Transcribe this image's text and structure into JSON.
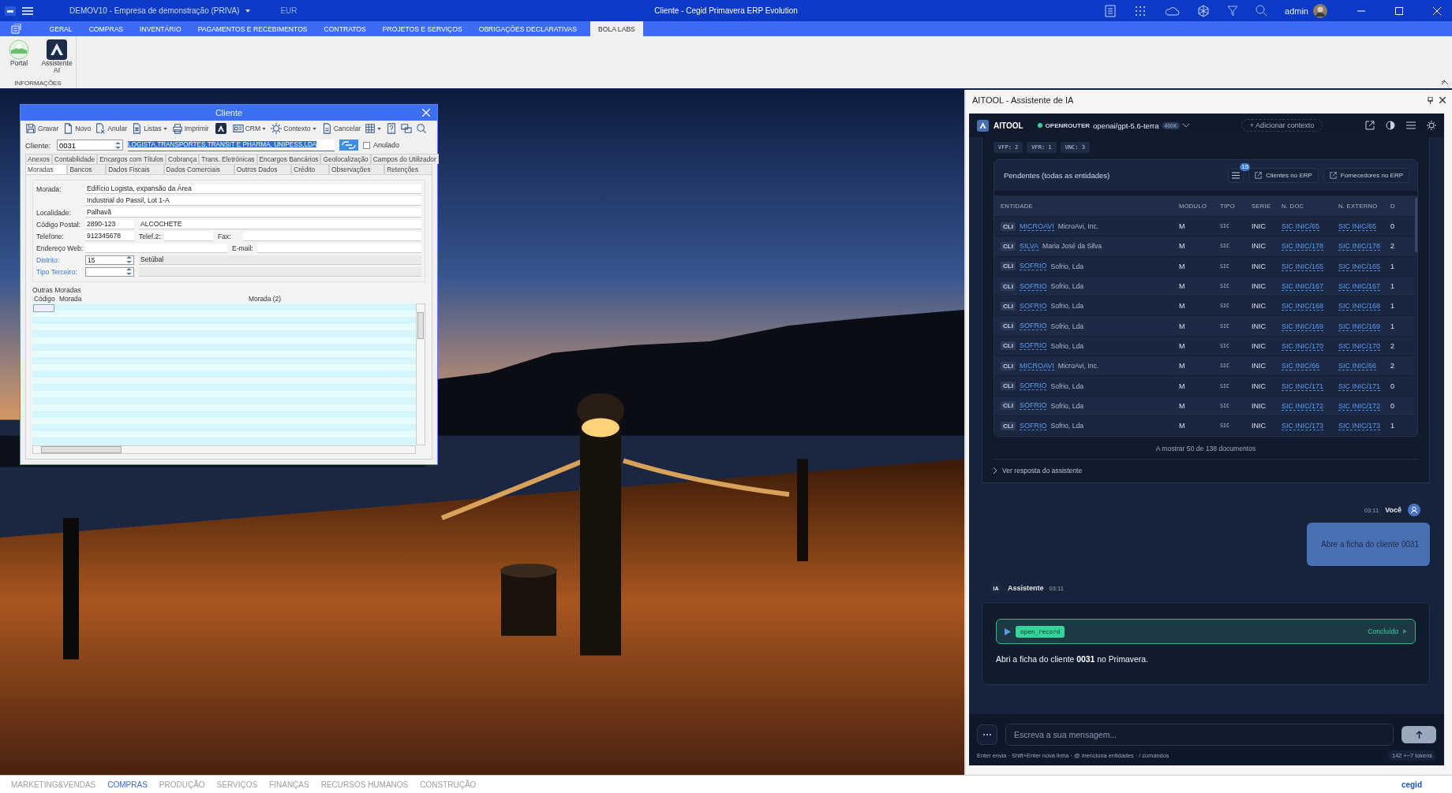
{
  "title_bar": {
    "company": "DEMOV10 - Empresa de demonstração (PRIVA)",
    "currency": "EUR",
    "title": "Cliente - Cegid Primavera ERP Evolution",
    "user": "admin"
  },
  "ribbon": {
    "tabs": [
      {
        "label": "GERAL",
        "selected": false
      },
      {
        "label": "COMPRAS",
        "selected": false
      },
      {
        "label": "INVENTÁRIO",
        "selected": false
      },
      {
        "label": "PAGAMENTOS E RECEBIMENTOS",
        "selected": false
      },
      {
        "label": "CONTRATOS",
        "selected": false
      },
      {
        "label": "PROJETOS E SERVIÇOS",
        "selected": false
      },
      {
        "label": "OBRIGAÇÕES DECLARATIVAS",
        "selected": false
      },
      {
        "label": "BOLA LABS",
        "selected": true
      }
    ],
    "buttons": [
      {
        "label": "Portal",
        "kind": "portal"
      },
      {
        "label": "Assistente AI",
        "kind": "assistant"
      }
    ],
    "group": "INFORMAÇÕES"
  },
  "client_window": {
    "title": "Cliente",
    "toolbar": [
      {
        "kind": "save",
        "label": "Gravar",
        "dropdown": false
      },
      {
        "kind": "new",
        "label": "Novo",
        "dropdown": false
      },
      {
        "kind": "void",
        "label": "Anular",
        "dropdown": false
      },
      {
        "kind": "lists",
        "label": "Listas",
        "dropdown": true
      },
      {
        "kind": "print",
        "label": "Imprimir",
        "dropdown": false
      },
      {
        "kind": "ai",
        "dropdown": false
      },
      {
        "kind": "crm",
        "label": "CRM",
        "dropdown": true
      },
      {
        "kind": "context",
        "label": "Contexto",
        "dropdown": true
      },
      {
        "kind": "cancel",
        "label": "Cancelar",
        "dropdown": false
      },
      {
        "kind": "grid",
        "dropdown": true
      },
      {
        "kind": "help",
        "dropdown": false
      },
      {
        "kind": "switch",
        "dropdown": false
      },
      {
        "kind": "search",
        "dropdown": false
      }
    ],
    "code_label": "Cliente:",
    "code": "0031",
    "name": "LOGISTA,TRANSPORTES,TRANSIT E PHARMA, UNIPESS,LDA",
    "void": {
      "label": "Anulado",
      "checked": false
    },
    "tabs_row_1": [
      {
        "label": "Anexos",
        "selected": false
      },
      {
        "label": "Contabilidade",
        "selected": false
      },
      {
        "label": "Encargos com Títulos",
        "selected": false
      },
      {
        "label": "Cobrança",
        "selected": false
      },
      {
        "label": "Trans. Eletrónicas",
        "selected": false
      },
      {
        "label": "Encargos Bancários",
        "selected": false
      },
      {
        "label": "Geolocalização",
        "selected": false
      },
      {
        "label": "Campos do Utilizador",
        "selected": false
      }
    ],
    "tabs_row_2": [
      {
        "label": "Moradas",
        "selected": true
      },
      {
        "label": "Bancos",
        "selected": false
      },
      {
        "label": "Dados Fiscais",
        "selected": false
      },
      {
        "label": "Dados Comerciais",
        "selected": false
      },
      {
        "label": "Outros Dados",
        "selected": false
      },
      {
        "label": "Crédito",
        "selected": false
      },
      {
        "label": "Observações",
        "selected": false
      },
      {
        "label": "Retenções",
        "selected": false
      }
    ],
    "address": {
      "morada_label": "Morada:",
      "morada_1": "Edifício Logista, expansão da Área",
      "morada_2": "Industrial do Passil, Lot 1-A",
      "localidade_label": "Localidade:",
      "localidade": "Palhavã",
      "postal_label": "Código Postal:",
      "postal_code": "2890-123",
      "postal_city": "ALCOCHETE",
      "phone_label": "Telefone:",
      "phone": "912345678",
      "phone2_label": "Telef.2:",
      "fax_label": "Fax:",
      "web_label": "Endereço Web:",
      "email_label": "E-mail:",
      "district_label": "Distrito:",
      "district_code": "15",
      "district_name": "Setúbal",
      "third_party_label": "Tipo Terceiro:"
    },
    "other_addresses": {
      "title": "Outras Moradas",
      "columns": [
        "Código",
        "Morada",
        "Morada (2)"
      ]
    }
  },
  "ai_panel": {
    "title": "AITOOL - Assistente de IA",
    "brand": "AITOOL",
    "provider": "OPENROUTER",
    "model": "openai/gpt-5.6-terra",
    "context_size": "400K",
    "add_context": "+ Adicionar contexto",
    "chips": [
      "VFP: 2",
      "VFR: 1",
      "VNC: 3"
    ],
    "pending": {
      "title": "Pendentes (todas as entidades)",
      "filter_count": "15",
      "buttons": [
        "Clientes no ERP",
        "Fornecedores no ERP"
      ],
      "columns": [
        "ENTIDADE",
        "MODULO",
        "TIPO",
        "SERIE",
        "N. DOC",
        "N. EXTERNO",
        "D"
      ],
      "rows": [
        {
          "type": "CLI",
          "code": "MICROAVI",
          "name": "MicroAvi, Inc.",
          "module": "M",
          "doc_type": "SIC",
          "series": "INIC",
          "doc": "SIC INIC/65",
          "external": "SIC INIC/65",
          "column_7": "0"
        },
        {
          "type": "CLI",
          "code": "SILVA",
          "name": "Maria José da Silva",
          "module": "M",
          "doc_type": "SIC",
          "series": "INIC",
          "doc": "SIC INIC/178",
          "external": "SIC INIC/178",
          "column_7": "2"
        },
        {
          "type": "CLI",
          "code": "SOFRIO",
          "name": "Sofrio, Lda",
          "module": "M",
          "doc_type": "SIC",
          "series": "INIC",
          "doc": "SIC INIC/165",
          "external": "SIC INIC/165",
          "column_7": "1"
        },
        {
          "type": "CLI",
          "code": "SOFRIO",
          "name": "Sofrio, Lda",
          "module": "M",
          "doc_type": "SIC",
          "series": "INIC",
          "doc": "SIC INIC/167",
          "external": "SIC INIC/167",
          "column_7": "1"
        },
        {
          "type": "CLI",
          "code": "SOFRIO",
          "name": "Sofrio, Lda",
          "module": "M",
          "doc_type": "SIC",
          "series": "INIC",
          "doc": "SIC INIC/168",
          "external": "SIC INIC/168",
          "column_7": "1"
        },
        {
          "type": "CLI",
          "code": "SOFRIO",
          "name": "Sofrio, Lda",
          "module": "M",
          "doc_type": "SIC",
          "series": "INIC",
          "doc": "SIC INIC/169",
          "external": "SIC INIC/169",
          "column_7": "1"
        },
        {
          "type": "CLI",
          "code": "SOFRIO",
          "name": "Sofrio, Lda",
          "module": "M",
          "doc_type": "SIC",
          "series": "INIC",
          "doc": "SIC INIC/170",
          "external": "SIC INIC/170",
          "column_7": "2"
        },
        {
          "type": "CLI",
          "code": "MICROAVI",
          "name": "MicroAvi, Inc.",
          "module": "M",
          "doc_type": "SIC",
          "series": "INIC",
          "doc": "SIC INIC/66",
          "external": "SIC INIC/66",
          "column_7": "2"
        },
        {
          "type": "CLI",
          "code": "SOFRIO",
          "name": "Sofrio, Lda",
          "module": "M",
          "doc_type": "SIC",
          "series": "INIC",
          "doc": "SIC INIC/171",
          "external": "SIC INIC/171",
          "column_7": "0"
        },
        {
          "type": "CLI",
          "code": "SOFRIO",
          "name": "Sofrio, Lda",
          "module": "M",
          "doc_type": "SIC",
          "series": "INIC",
          "doc": "SIC INIC/172",
          "external": "SIC INIC/172",
          "column_7": "0"
        },
        {
          "type": "CLI",
          "code": "SOFRIO",
          "name": "Sofrio, Lda",
          "module": "M",
          "doc_type": "SIC",
          "series": "INIC",
          "doc": "SIC INIC/173",
          "external": "SIC INIC/173",
          "column_7": "1"
        }
      ],
      "footer": "A mostrar 50 de 138 documentos"
    },
    "toggle": "Ver resposta do assistente",
    "user_message": {
      "time": "03:11",
      "author": "Você",
      "text": "Abre a ficha do cliente 0031"
    },
    "assistant_message": {
      "badge": "IA",
      "author": "Assistente",
      "time": "03:11",
      "tool": "open_record",
      "tool_status": "Concluído",
      "text": "Abri a ficha do cliente **0031** no Primavera."
    },
    "input": {
      "placeholder": "Escreva a sua mensagem...",
      "hint": "Enter envia · Shift+Enter nova linha · @ menciona entidades · / comandos",
      "tokens": "142 +~7 tokens"
    }
  },
  "modules": [
    {
      "label": "MARKETING&VENDAS",
      "selected": false
    },
    {
      "label": "COMPRAS",
      "selected": true
    },
    {
      "label": "PRODUÇÃO",
      "selected": false
    },
    {
      "label": "SERVIÇOS",
      "selected": false
    },
    {
      "label": "FINANÇAS",
      "selected": false
    },
    {
      "label": "RECURSOS HUMANOS",
      "selected": false
    },
    {
      "label": "CONSTRUÇÃO",
      "selected": false
    }
  ],
  "brand": "cegid"
}
